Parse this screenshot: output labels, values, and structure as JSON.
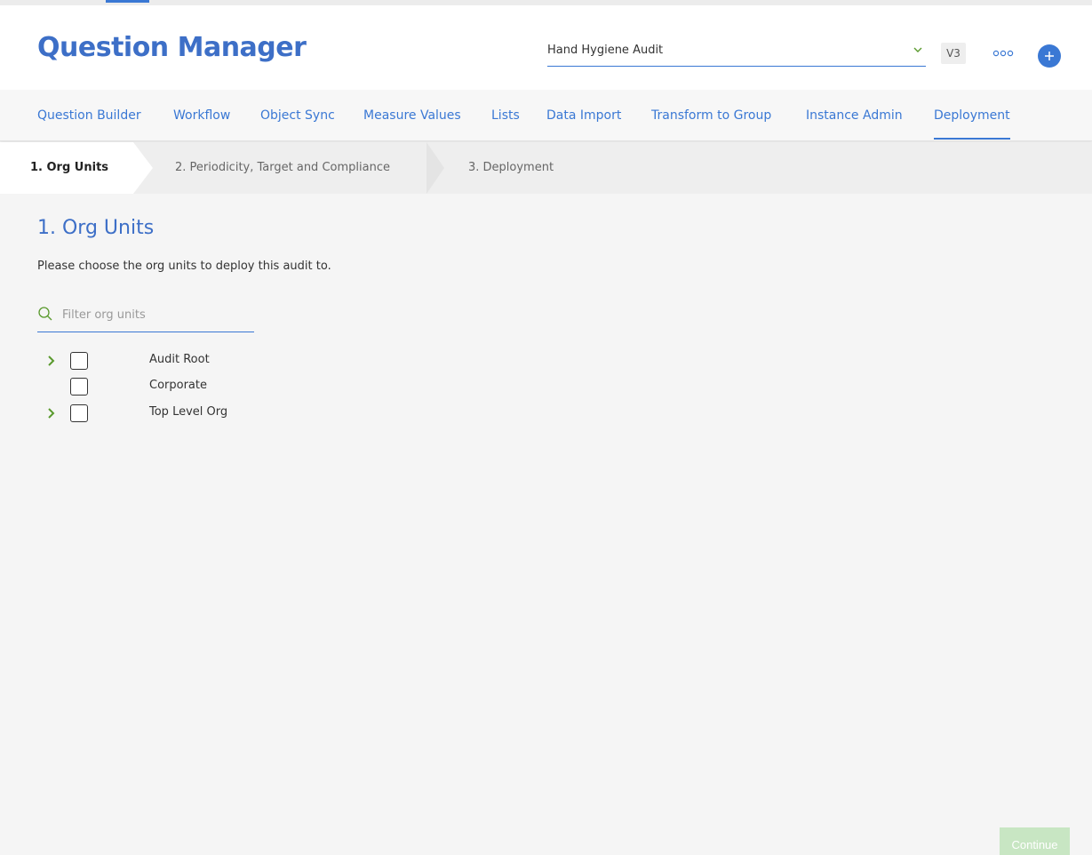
{
  "colors": {
    "brand": "#3d6fc7",
    "accent": "#3a78d4",
    "expander": "#5a9a2e",
    "continue_disabled": "#c8e6c3"
  },
  "header": {
    "title": "Question Manager",
    "audit_select": {
      "value": "Hand Hygiene Audit",
      "icon": "chevron-down-icon"
    },
    "version": "V3",
    "more_icon": "more-icon",
    "add_icon": "plus-icon"
  },
  "nav": {
    "items": [
      {
        "label": "Question Builder"
      },
      {
        "label": "Workflow"
      },
      {
        "label": "Object Sync"
      },
      {
        "label": "Measure Values"
      },
      {
        "label": "Lists"
      },
      {
        "label": "Data Import"
      },
      {
        "label": "Transform to Group"
      },
      {
        "label": "Instance Admin"
      },
      {
        "label": "Deployment",
        "active": true
      }
    ]
  },
  "steps": [
    {
      "label": "1. Org Units",
      "active": true
    },
    {
      "label": "2. Periodicity, Target and Compliance"
    },
    {
      "label": "3. Deployment"
    }
  ],
  "content": {
    "title": "1. Org Units",
    "description": "Please choose the org units to deploy this audit to.",
    "filter": {
      "placeholder": "Filter org units",
      "value": ""
    },
    "org_units": [
      {
        "label": "Audit Root",
        "expandable": true,
        "checked": false
      },
      {
        "label": "Corporate",
        "expandable": false,
        "checked": false
      },
      {
        "label": "Top Level Org",
        "expandable": true,
        "checked": false
      }
    ]
  },
  "footer": {
    "continue_label": "Continue",
    "continue_enabled": false
  }
}
